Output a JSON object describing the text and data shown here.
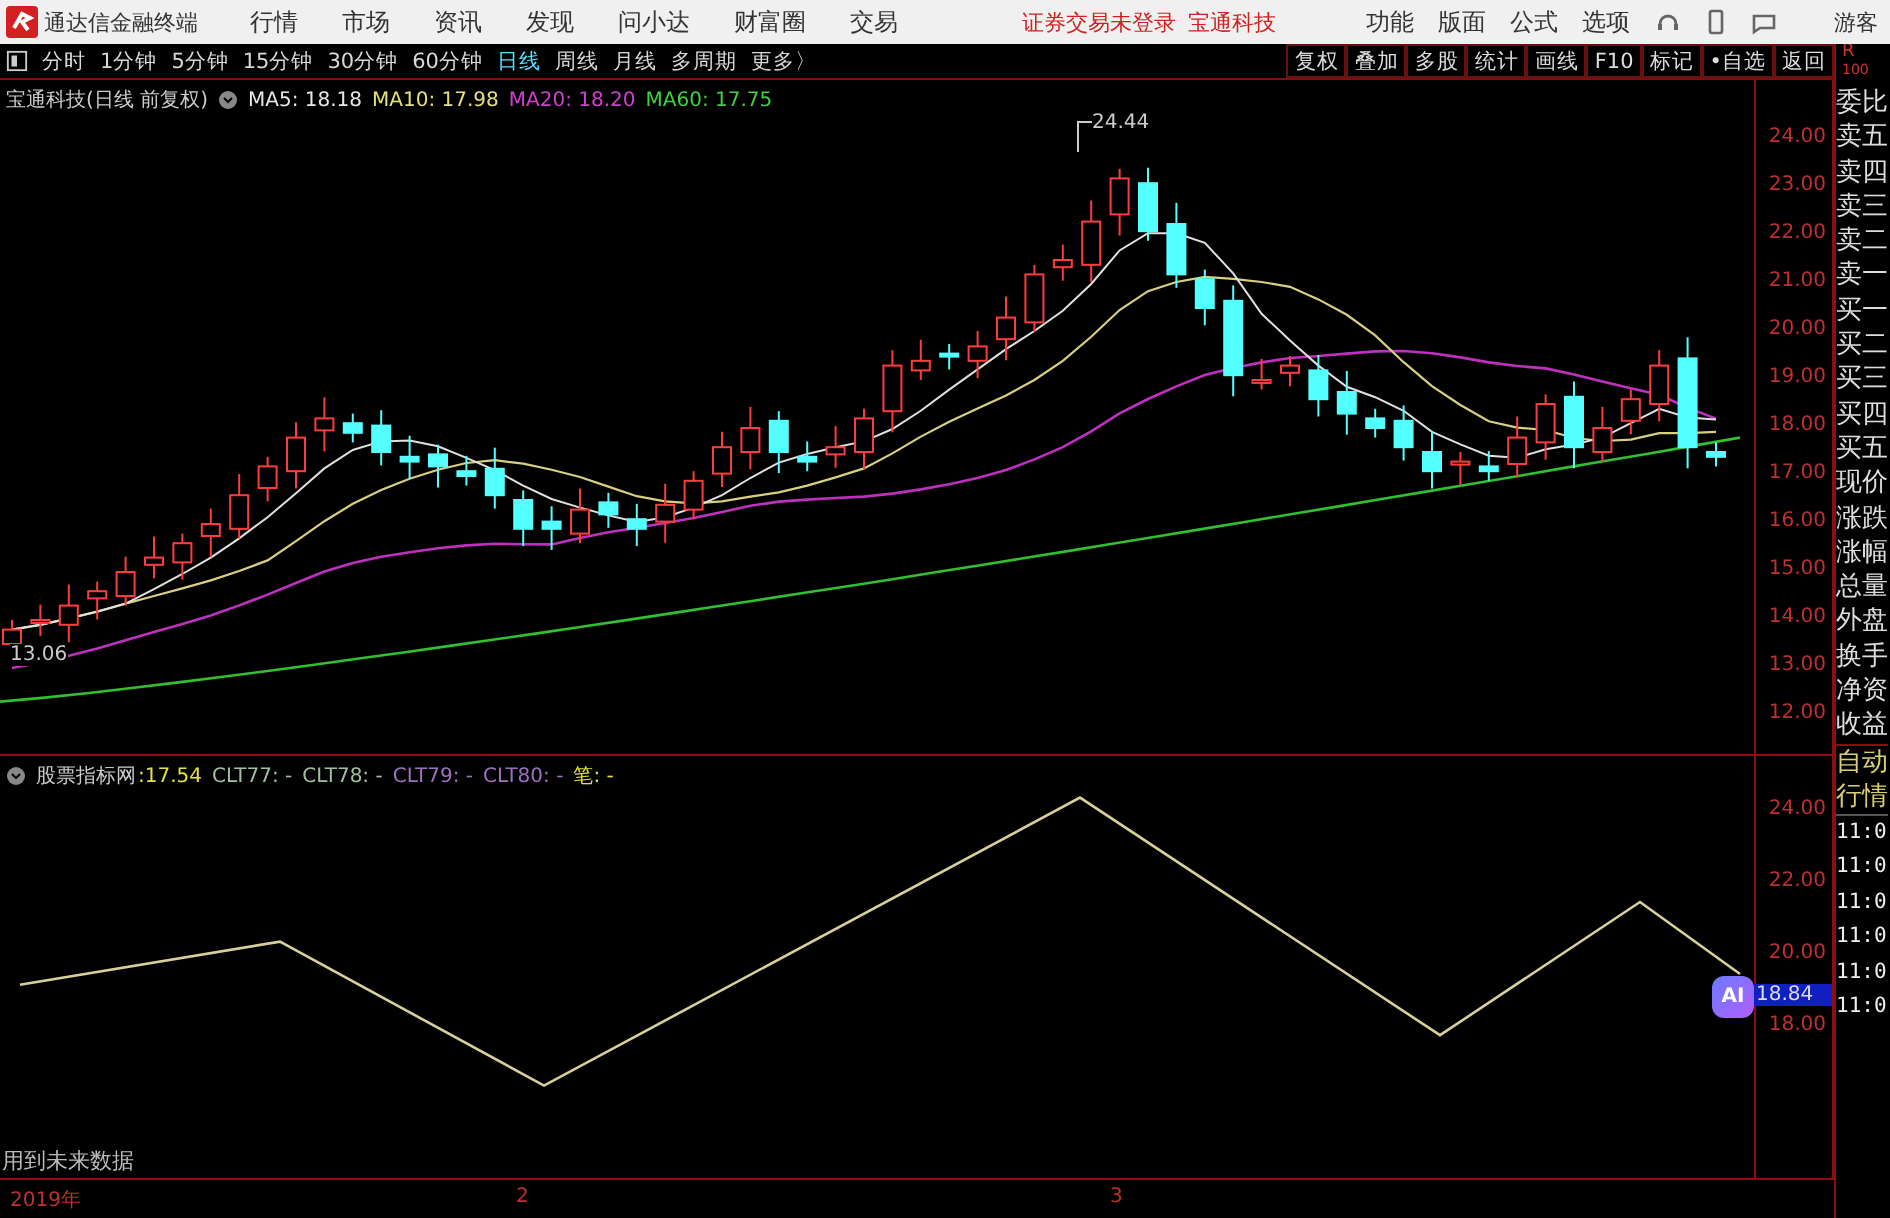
{
  "title_bar": {
    "app_name": "通达信金融终端",
    "menus": [
      "行情",
      "市场",
      "资讯",
      "发现",
      "问小达",
      "财富圈",
      "交易"
    ],
    "notice": "证券交易未登录",
    "stock": "宝通科技",
    "tools": [
      "功能",
      "版面",
      "公式",
      "选项"
    ],
    "user": "游客"
  },
  "period_tabs": [
    {
      "label": "分时",
      "selected": false
    },
    {
      "label": "1分钟",
      "selected": false
    },
    {
      "label": "5分钟",
      "selected": false
    },
    {
      "label": "15分钟",
      "selected": false
    },
    {
      "label": "30分钟",
      "selected": false
    },
    {
      "label": "60分钟",
      "selected": false
    },
    {
      "label": "日线",
      "selected": true
    },
    {
      "label": "周线",
      "selected": false
    },
    {
      "label": "月线",
      "selected": false
    },
    {
      "label": "多周期",
      "selected": false
    },
    {
      "label": "更多〉",
      "selected": false
    }
  ],
  "chart_tools": [
    "复权",
    "叠加",
    "多股",
    "统计",
    "画线",
    "F10",
    "标记",
    "•自选",
    "返回"
  ],
  "main_chart": {
    "stock_label": "宝通科技(日线 前复权)",
    "ma_legend": [
      {
        "label": "MA5: 18.18",
        "color": "#e8e8e8"
      },
      {
        "label": "MA10: 17.98",
        "color": "#e6e07a"
      },
      {
        "label": "MA20: 18.20",
        "color": "#d040d0"
      },
      {
        "label": "MA60: 17.75",
        "color": "#40d040"
      }
    ],
    "high_label": "24.44",
    "low_label": "13.06",
    "price_axis": [
      "24.00",
      "23.00",
      "22.00",
      "21.00",
      "20.00",
      "19.00",
      "18.00",
      "17.00",
      "16.00",
      "15.00",
      "14.00",
      "13.00",
      "12.00"
    ]
  },
  "indicator": {
    "name": "股票指标网",
    "value": ":17.54",
    "legend": [
      {
        "label": "CLT77: -",
        "color": "#a0c0a0"
      },
      {
        "label": "CLT78: -",
        "color": "#a0c0a0"
      },
      {
        "label": "CLT79: -",
        "color": "#a070c0"
      },
      {
        "label": "CLT80: -",
        "color": "#a070c0"
      },
      {
        "label": "笔: -",
        "color": "#e6e040"
      }
    ],
    "axis": [
      "24.00",
      "22.00",
      "20.00",
      "18.00"
    ],
    "current": "18.84",
    "ai_badge": "AI",
    "note": "用到未来数据"
  },
  "x_axis": [
    "2019年",
    "2",
    "3"
  ],
  "side_panel": {
    "header": [
      "R",
      "100"
    ],
    "quote_labels": [
      "委比",
      "卖五",
      "卖四",
      "卖三",
      "卖二",
      "卖一",
      "买一",
      "买二",
      "买三",
      "买四",
      "买五",
      "现价",
      "涨跌",
      "涨幅",
      "总量",
      "外盘",
      "换手",
      "净资",
      "收益"
    ],
    "tabs": [
      "自动",
      "行情"
    ],
    "times": [
      "11:0",
      "11:0",
      "11:0",
      "11:0",
      "11:0",
      "11:0"
    ]
  }
}
